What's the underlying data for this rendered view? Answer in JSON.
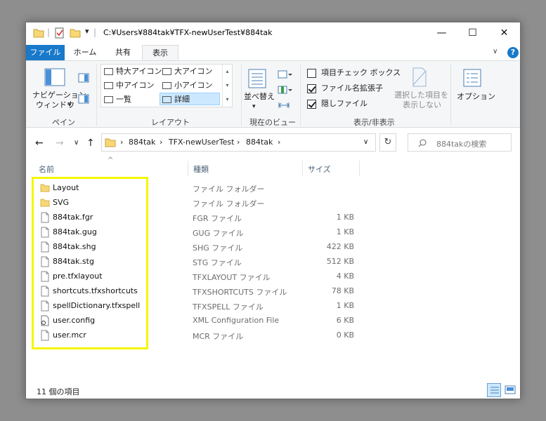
{
  "window": {
    "path_title": "C:¥Users¥884tak¥TFX-newUserTest¥884tak",
    "minimize": "—",
    "maximize": "☐",
    "close": "✕"
  },
  "tabs": [
    {
      "label": "ファイル"
    },
    {
      "label": "ホーム"
    },
    {
      "label": "共有"
    },
    {
      "label": "表示"
    }
  ],
  "help": "?",
  "ribbon": {
    "pane": {
      "nav_label1": "ナビゲーション",
      "nav_label2": "ウィンドウ",
      "group": "ペイン"
    },
    "layout": {
      "items": [
        "特大アイコン",
        "大アイコン",
        "中アイコン",
        "小アイコン",
        "一覧",
        "詳細"
      ],
      "selected": "詳細",
      "group": "レイアウト"
    },
    "current_view": {
      "sort_label1": "並べ替え",
      "group": "現在のビュー"
    },
    "show_hide": {
      "item_checkbox": "項目チェック ボックス",
      "item_checkbox_checked": false,
      "file_ext": "ファイル名拡張子",
      "file_ext_checked": true,
      "hidden": "隠しファイル",
      "hidden_checked": true,
      "hide_selected_1": "選択した項目を",
      "hide_selected_2": "表示しない",
      "group": "表示/非表示"
    },
    "options": "オプション"
  },
  "address": {
    "crumbs": [
      "884tak",
      "TFX-newUserTest",
      "884tak"
    ],
    "search_placeholder": "884takの検索"
  },
  "columns": {
    "name": "名前",
    "type": "種類",
    "size": "サイズ"
  },
  "files": [
    {
      "name": "Layout",
      "type": "ファイル フォルダー",
      "size": "",
      "icon": "folder-icon"
    },
    {
      "name": "SVG",
      "type": "ファイル フォルダー",
      "size": "",
      "icon": "folder-icon"
    },
    {
      "name": "884tak.fgr",
      "type": "FGR ファイル",
      "size": "1 KB",
      "icon": "file-icon"
    },
    {
      "name": "884tak.gug",
      "type": "GUG ファイル",
      "size": "1 KB",
      "icon": "file-icon"
    },
    {
      "name": "884tak.shg",
      "type": "SHG ファイル",
      "size": "422 KB",
      "icon": "file-icon"
    },
    {
      "name": "884tak.stg",
      "type": "STG ファイル",
      "size": "512 KB",
      "icon": "file-icon"
    },
    {
      "name": "pre.tfxlayout",
      "type": "TFXLAYOUT ファイル",
      "size": "4 KB",
      "icon": "file-icon"
    },
    {
      "name": "shortcuts.tfxshortcuts",
      "type": "TFXSHORTCUTS ファイル",
      "size": "78 KB",
      "icon": "file-icon"
    },
    {
      "name": "spellDictionary.tfxspell",
      "type": "TFXSPELL ファイル",
      "size": "1 KB",
      "icon": "file-icon"
    },
    {
      "name": "user.config",
      "type": "XML Configuration File",
      "size": "6 KB",
      "icon": "config-file-icon"
    },
    {
      "name": "user.mcr",
      "type": "MCR ファイル",
      "size": "0 KB",
      "icon": "file-icon"
    }
  ],
  "status": "11 個の項目",
  "colors": {
    "accent": "#1979ca",
    "highlight_box": "#f5f500",
    "selected_bg": "#cce8ff",
    "folder": "#f8d775"
  }
}
